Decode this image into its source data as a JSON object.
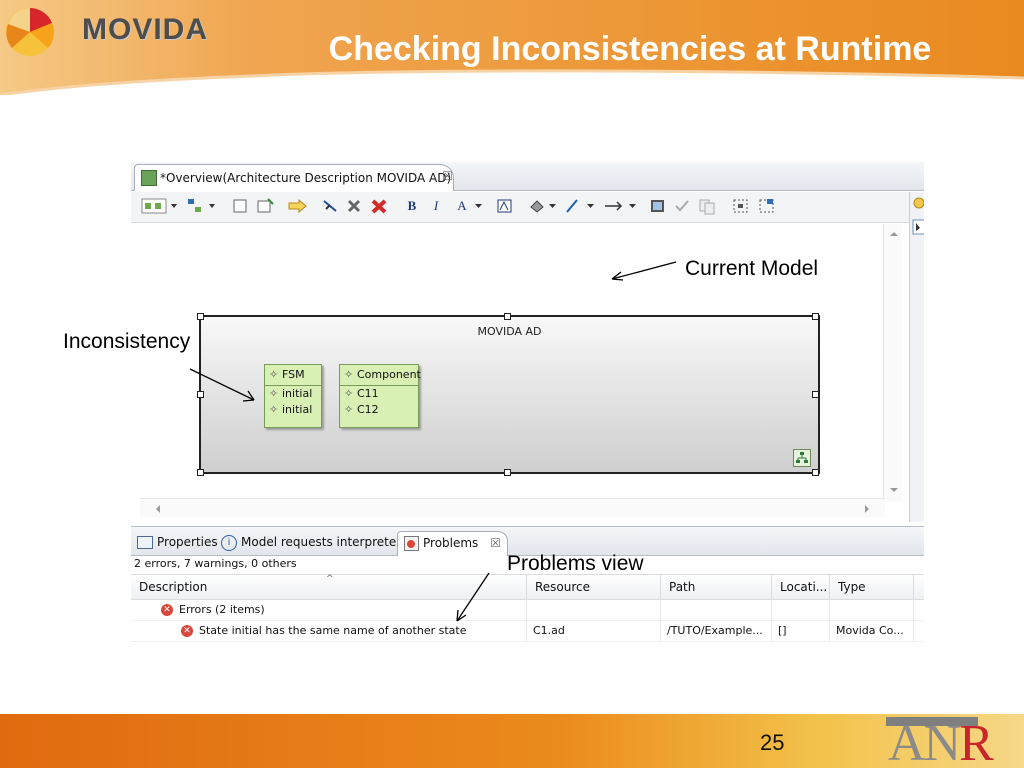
{
  "slide": {
    "logo_text": "MOVIDA",
    "title": "Checking Inconsistencies at Runtime",
    "page_number": "25",
    "footer_logo": "ANR",
    "colors": {
      "header_orange": "#e98a1f",
      "accent_red": "#c8262a",
      "annotation": "#000000"
    }
  },
  "editor": {
    "tab_label": "*Overview(Architecture Description MOVIDA AD)",
    "tab_close": "☒",
    "container_title": "MOVIDA AD",
    "toolbar": [
      "B",
      "I",
      "A"
    ],
    "nodes": [
      {
        "name": "FSM",
        "items": [
          "initial",
          "initial"
        ]
      },
      {
        "name": "Component",
        "items": [
          "C11",
          "C12"
        ]
      }
    ]
  },
  "annotations": {
    "current_model": "Current Model",
    "inconsistency": "Inconsistency",
    "problems_view": "Problems view"
  },
  "views": {
    "tabs": [
      "Properties",
      "Model requests interpreter",
      "Problems"
    ],
    "active_tab": "Problems",
    "summary": "2 errors, 7 warnings, 0 others",
    "columns": [
      "Description",
      "Resource",
      "Path",
      "Locati...",
      "Type"
    ],
    "rows": [
      {
        "description": "Errors (2 items)",
        "resource": "",
        "path": "",
        "location": "",
        "type": ""
      },
      {
        "description": "State  initial has the same name of another state",
        "resource": "C1.ad",
        "path": "/TUTO/Example...",
        "location": "[]",
        "type": "Movida Co..."
      }
    ]
  }
}
